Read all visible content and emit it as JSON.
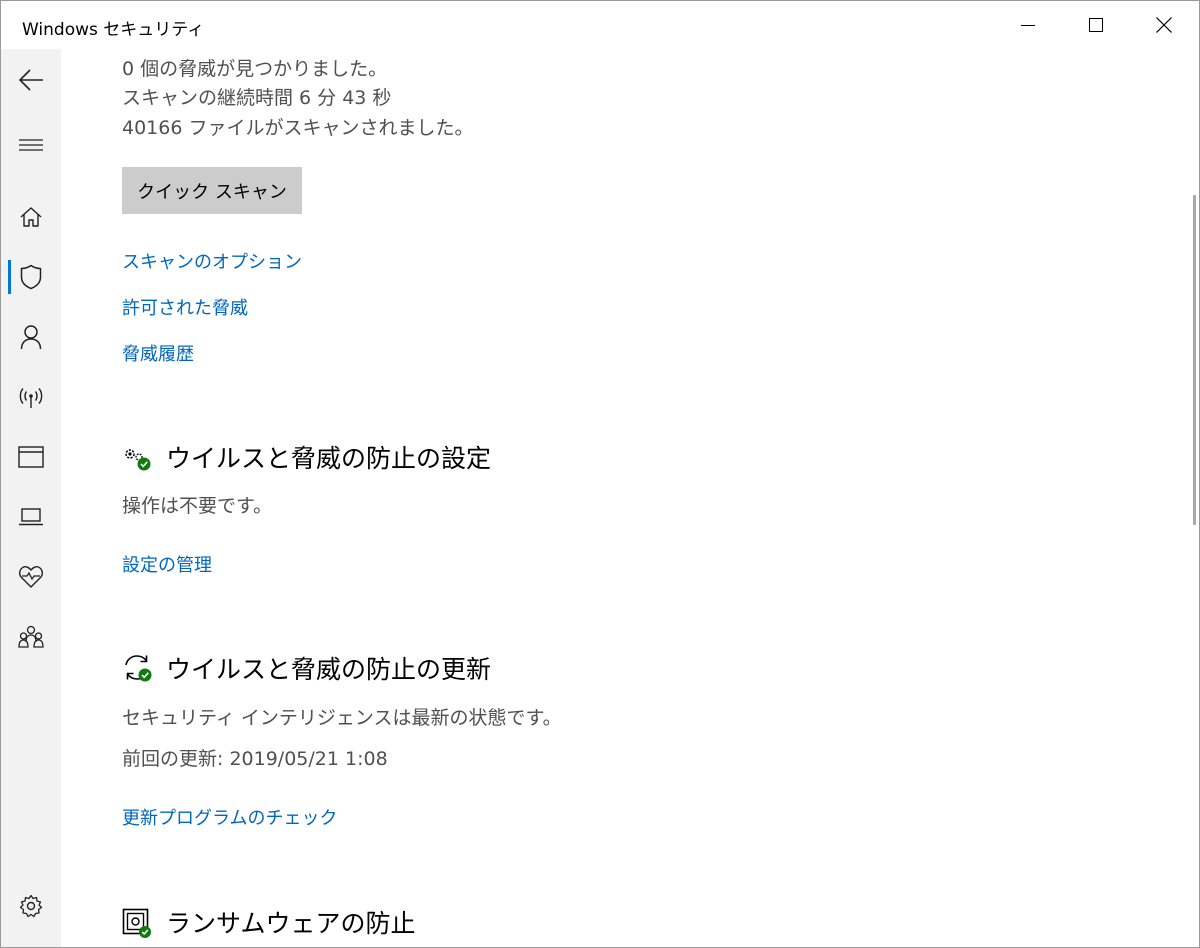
{
  "window": {
    "title": "Windows セキュリティ"
  },
  "sidebar": {
    "active": "virus-protection",
    "items": [
      {
        "id": "back",
        "icon": "back-arrow-icon"
      },
      {
        "id": "menu",
        "icon": "hamburger-menu-icon"
      },
      {
        "id": "home",
        "icon": "home-icon"
      },
      {
        "id": "virus-protection",
        "icon": "shield-icon"
      },
      {
        "id": "account",
        "icon": "person-icon"
      },
      {
        "id": "firewall",
        "icon": "wireless-antenna-icon"
      },
      {
        "id": "app-browser",
        "icon": "browser-window-icon"
      },
      {
        "id": "device-security",
        "icon": "laptop-icon"
      },
      {
        "id": "device-health",
        "icon": "heart-pulse-icon"
      },
      {
        "id": "family",
        "icon": "family-icon"
      },
      {
        "id": "settings",
        "icon": "gear-icon"
      }
    ]
  },
  "scan": {
    "threats_found": "0 個の脅威が見つかりました。",
    "duration": "スキャンの継続時間 6 分 43 秒",
    "files_scanned": "40166 ファイルがスキャンされました。",
    "quick_scan_button": "クイック スキャン",
    "links": {
      "scan_options": "スキャンのオプション",
      "allowed_threats": "許可された脅威",
      "threat_history": "脅威履歴"
    }
  },
  "settings_section": {
    "heading": "ウイルスと脅威の防止の設定",
    "status": "操作は不要です。",
    "link": "設定の管理"
  },
  "updates_section": {
    "heading": "ウイルスと脅威の防止の更新",
    "status": "セキュリティ インテリジェンスは最新の状態です。",
    "last_update": "前回の更新: 2019/05/21 1:08",
    "link": "更新プログラムのチェック"
  },
  "ransomware_section": {
    "heading": "ランサムウェアの防止"
  },
  "colors": {
    "accent": "#0078d7",
    "link": "#0067c0",
    "status_ok": "#107c10",
    "sidebar_bg": "#f2f2f2",
    "button_bg": "#cccccc"
  }
}
